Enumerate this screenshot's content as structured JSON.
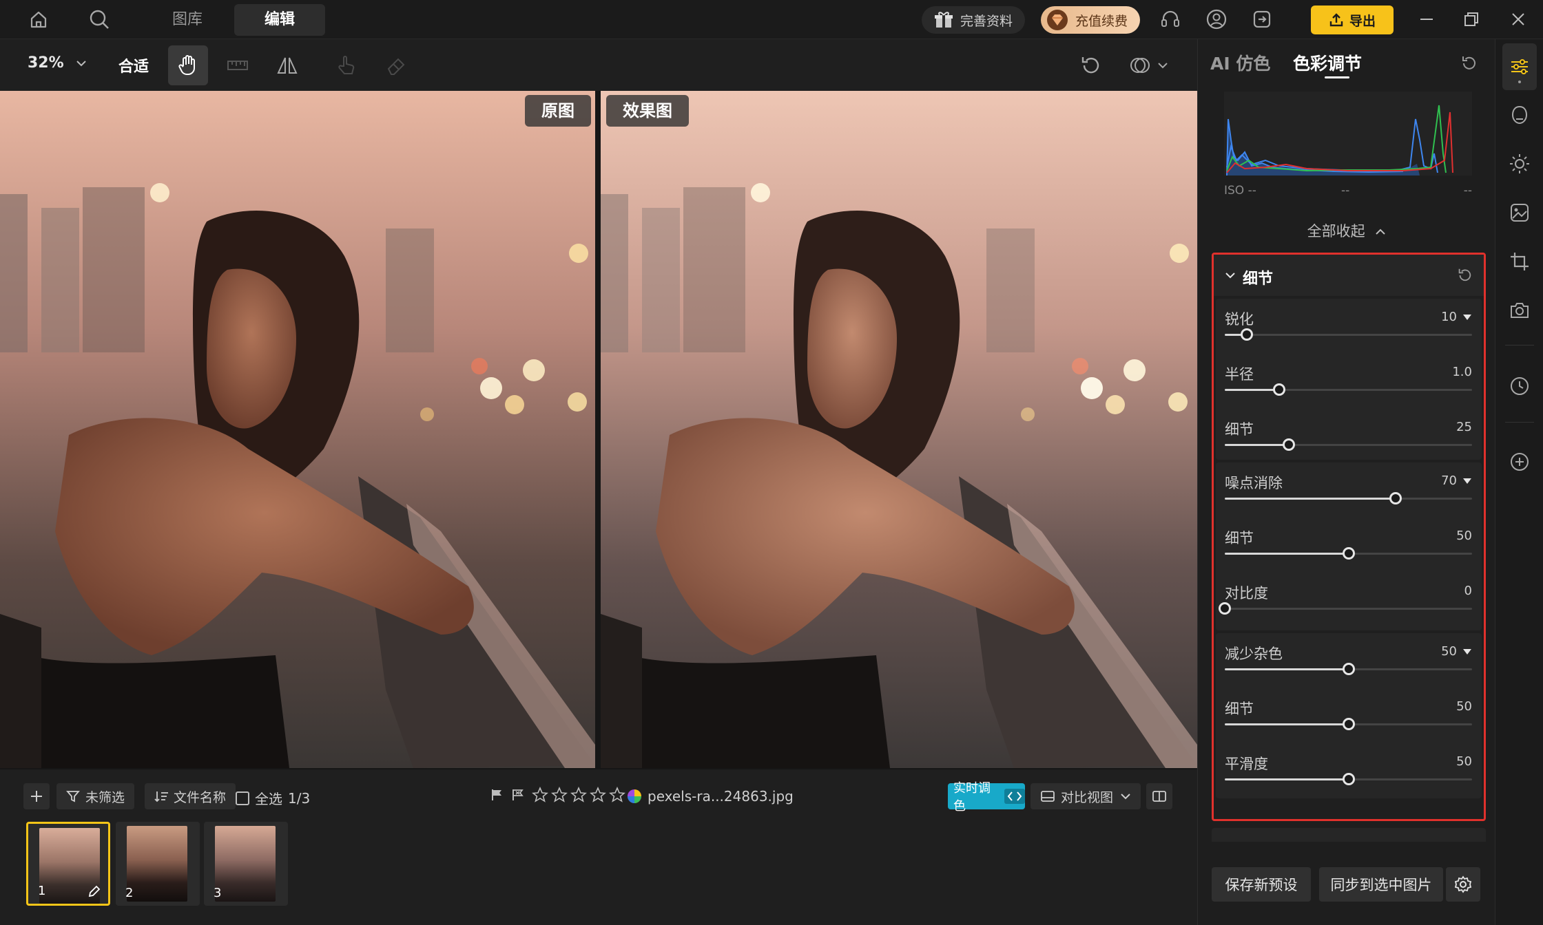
{
  "topbar": {
    "tabs": [
      "图库",
      "编辑"
    ],
    "profile_label": "完善资料",
    "recharge_label": "充值续费",
    "export_label": "导出"
  },
  "toolbar": {
    "zoom": "32%",
    "fit": "合适"
  },
  "canvas": {
    "before_label": "原图",
    "after_label": "效果图"
  },
  "bottom": {
    "filter_label": "未筛选",
    "sort_label": "文件名称",
    "select_all": "全选",
    "count": "1/3",
    "filename": "pexels-ra...24863.jpg",
    "realtime_label": "实时调色",
    "compare_view": "对比视图",
    "thumbs": [
      "1",
      "2",
      "3"
    ]
  },
  "panel": {
    "tab_ai": "AI 仿色",
    "tab_color": "色彩调节",
    "iso": "ISO --",
    "hist_dash1": "--",
    "hist_dash2": "--",
    "collapse_all": "全部收起",
    "section_title": "细节",
    "sliders": [
      {
        "name": "锐化",
        "value": "10",
        "dropdown": true,
        "fraction": 0.09
      },
      {
        "name": "半径",
        "value": "1.0",
        "dropdown": false,
        "fraction": 0.22
      },
      {
        "name": "细节",
        "value": "25",
        "dropdown": false,
        "fraction": 0.26
      },
      {
        "name": "噪点消除",
        "value": "70",
        "dropdown": true,
        "fraction": 0.69
      },
      {
        "name": "细节",
        "value": "50",
        "dropdown": false,
        "fraction": 0.5
      },
      {
        "name": "对比度",
        "value": "0",
        "dropdown": false,
        "fraction": 0.0
      },
      {
        "name": "减少杂色",
        "value": "50",
        "dropdown": true,
        "fraction": 0.5
      },
      {
        "name": "细节",
        "value": "50",
        "dropdown": false,
        "fraction": 0.5
      },
      {
        "name": "平滑度",
        "value": "50",
        "dropdown": false,
        "fraction": 0.5
      }
    ],
    "save_preset": "保存新预设",
    "sync": "同步到选中图片"
  }
}
